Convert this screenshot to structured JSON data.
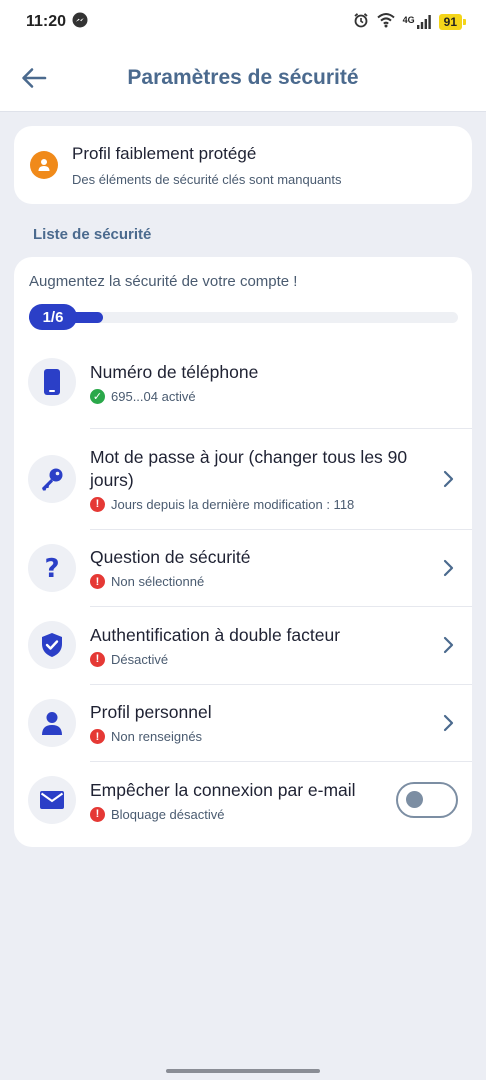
{
  "status_bar": {
    "time": "11:20",
    "network": "4G",
    "battery": "91"
  },
  "header": {
    "title": "Paramètres de sécurité"
  },
  "status_card": {
    "title": "Profil faiblement protégé",
    "subtitle": "Des éléments de sécurité clés sont manquants"
  },
  "section_label": "Liste de sécurité",
  "security_list": {
    "heading": "Augmentez la sécurité de votre compte !",
    "progress_label": "1/6",
    "progress_fraction": 0.1667,
    "items": [
      {
        "title": "Numéro de téléphone",
        "status": "695...04 activé",
        "state": "ok",
        "icon": "phone-icon"
      },
      {
        "title": "Mot de passe à jour (changer tous les 90 jours)",
        "status": "Jours depuis la dernière modification :  118",
        "state": "warn",
        "icon": "key-icon"
      },
      {
        "title": "Question de sécurité",
        "status": "Non sélectionné",
        "state": "warn",
        "icon": "question-icon"
      },
      {
        "title": "Authentification à double facteur",
        "status": "Désactivé",
        "state": "warn",
        "icon": "shield-icon"
      },
      {
        "title": "Profil personnel",
        "status": "Non renseignés",
        "state": "warn",
        "icon": "person-icon"
      },
      {
        "title": "Empêcher la connexion par e-mail",
        "status": "Bloquage désactivé",
        "state": "warn",
        "icon": "mail-icon",
        "toggle_on": false
      }
    ]
  },
  "colors": {
    "accent": "#2b3fc7",
    "title": "#4b6a8e",
    "warning": "#e53935",
    "success": "#2aa84a",
    "profile_alert": "#f08a1a"
  }
}
